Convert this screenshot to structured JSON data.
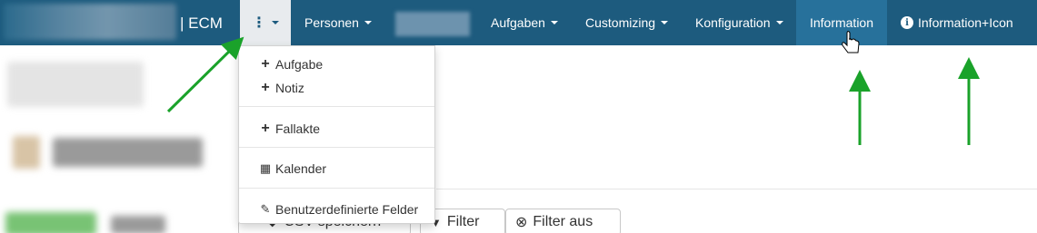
{
  "navbar": {
    "brand": "| ECM",
    "items": [
      {
        "label": "Personen"
      },
      {
        "label": "Aufgaben"
      },
      {
        "label": "Customizing"
      },
      {
        "label": "Konfiguration"
      },
      {
        "label": "Information"
      },
      {
        "label": "Information+Icon"
      }
    ],
    "kebab_symbol": "⋮"
  },
  "dropdown": {
    "items": [
      {
        "label": "Aufgabe",
        "icon": "plus-icon"
      },
      {
        "label": "Notiz",
        "icon": "plus-icon"
      },
      {
        "label": "Fallakte",
        "icon": "plus-icon"
      },
      {
        "label": "Kalender",
        "icon": "calendar-icon"
      },
      {
        "label": "Benutzerdefinierte Felder",
        "icon": "pencil-icon"
      }
    ]
  },
  "toolbar": {
    "csv_label": "CSV speichern",
    "filter_label": "Filter",
    "filter_off_label": "Filter aus"
  },
  "colors": {
    "navbar": "#1d5b7e",
    "navbar_active": "#27719b",
    "annotation_arrow": "#1aa22a"
  }
}
